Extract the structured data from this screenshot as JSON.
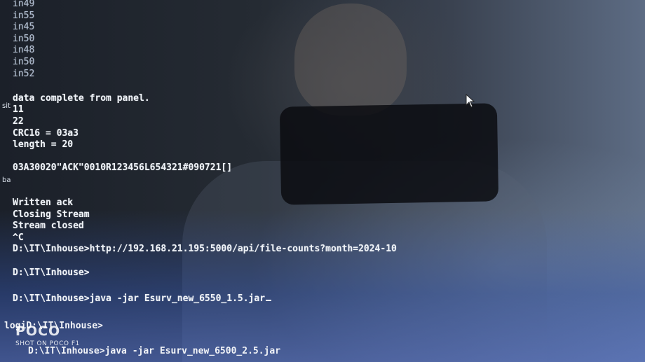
{
  "terminal": {
    "scroll_lines": [
      "in49",
      "in55",
      "in45",
      "in50",
      "in48",
      "in50",
      "in52"
    ],
    "block1": [
      "data complete from panel.",
      "11",
      "22",
      "CRC16 = 03a3",
      "length = 20"
    ],
    "packet": "03A30020\"ACK\"0010R123456L654321#090721[]",
    "block2": [
      "Written ack",
      "Closing Stream",
      "Stream closed",
      "^C"
    ],
    "cmd1": "D:\\IT\\Inhouse>http://192.168.21.195:5000/api/file-counts?month=2024-10",
    "prompt1": "D:\\IT\\Inhouse>",
    "cmd2": "D:\\IT\\Inhouse>java -jar Esurv_new_6550_1.5.jar",
    "prompt2": "D:\\IT\\Inhouse>",
    "cmd3": "D:\\IT\\Inhouse>java -jar Esurv_new_6500_2.5.jar"
  },
  "edge_labels": {
    "left1": "sit",
    "left2": "ba",
    "left3": "logi"
  },
  "watermark": {
    "brand": "POCO",
    "sub": "SHOT ON POCO F1"
  },
  "icons": {
    "pointer": "mouse-pointer-icon"
  },
  "colors": {
    "text": "#eef2f7",
    "background": "#1b2029"
  }
}
